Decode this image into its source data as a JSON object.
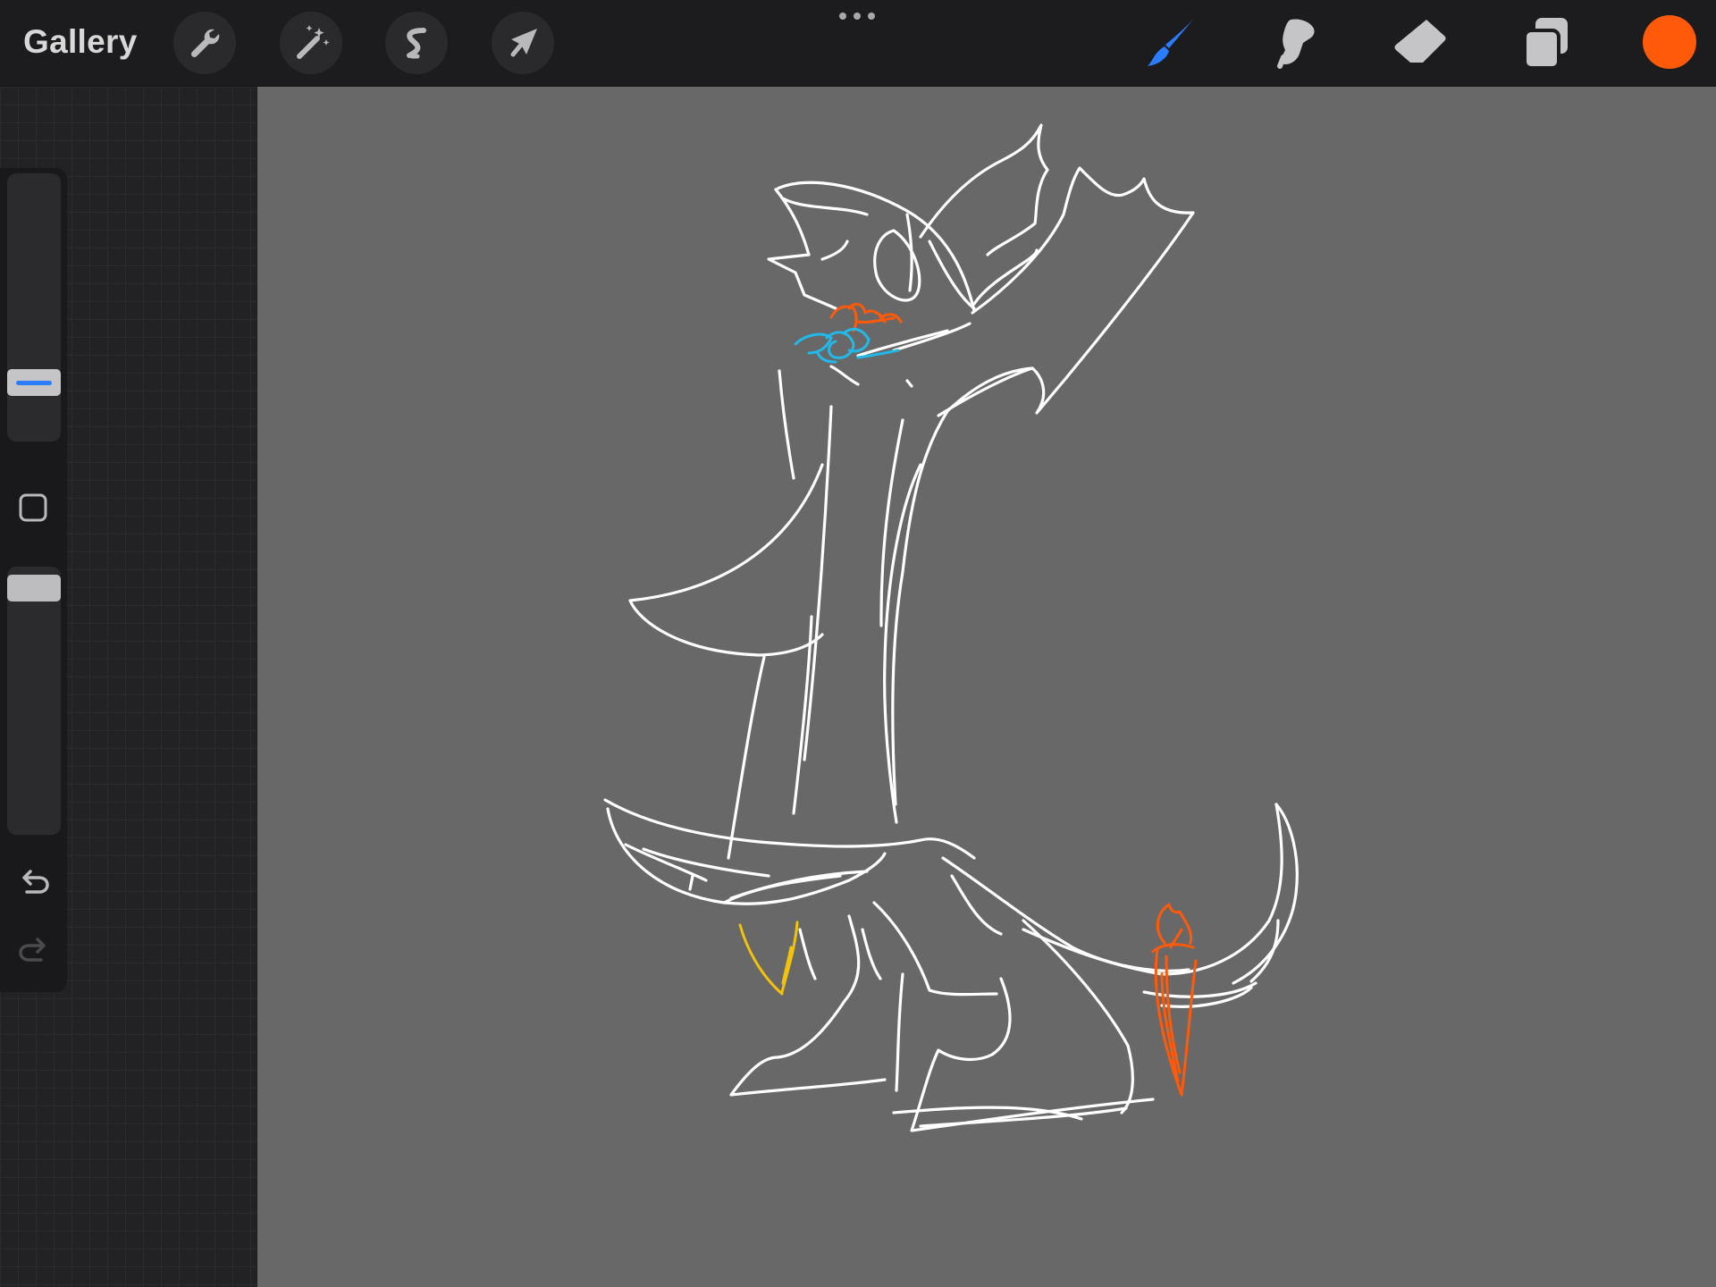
{
  "toolbar": {
    "gallery_label": "Gallery",
    "left_tools": [
      {
        "name": "actions",
        "icon": "wrench-icon"
      },
      {
        "name": "adjustments",
        "icon": "magic-wand-icon"
      },
      {
        "name": "selection",
        "icon": "selection-s-icon"
      },
      {
        "name": "transform",
        "icon": "arrow-cursor-icon"
      }
    ],
    "right_tools": [
      {
        "name": "brush",
        "icon": "brush-icon",
        "active": true
      },
      {
        "name": "smudge",
        "icon": "smudge-finger-icon",
        "active": false
      },
      {
        "name": "eraser",
        "icon": "eraser-icon",
        "active": false
      },
      {
        "name": "layers",
        "icon": "layers-icon",
        "active": false
      }
    ],
    "current_color": "#ff5a0a"
  },
  "sidebar": {
    "brush_size_slider": "size",
    "brush_opacity_slider": "opacity",
    "modify_icon": "square-modify-icon",
    "undo_icon": "undo-arrow-icon",
    "redo_icon": "redo-arrow-icon"
  },
  "colors": {
    "accent_blue": "#2b7dff",
    "canvas_bg": "#686868",
    "stroke_white": "#ffffff",
    "stroke_orange": "#ff5a0a",
    "stroke_cyan": "#22b8e8",
    "stroke_yellow": "#f2c20c"
  },
  "canvas": {
    "content": "sketch"
  }
}
